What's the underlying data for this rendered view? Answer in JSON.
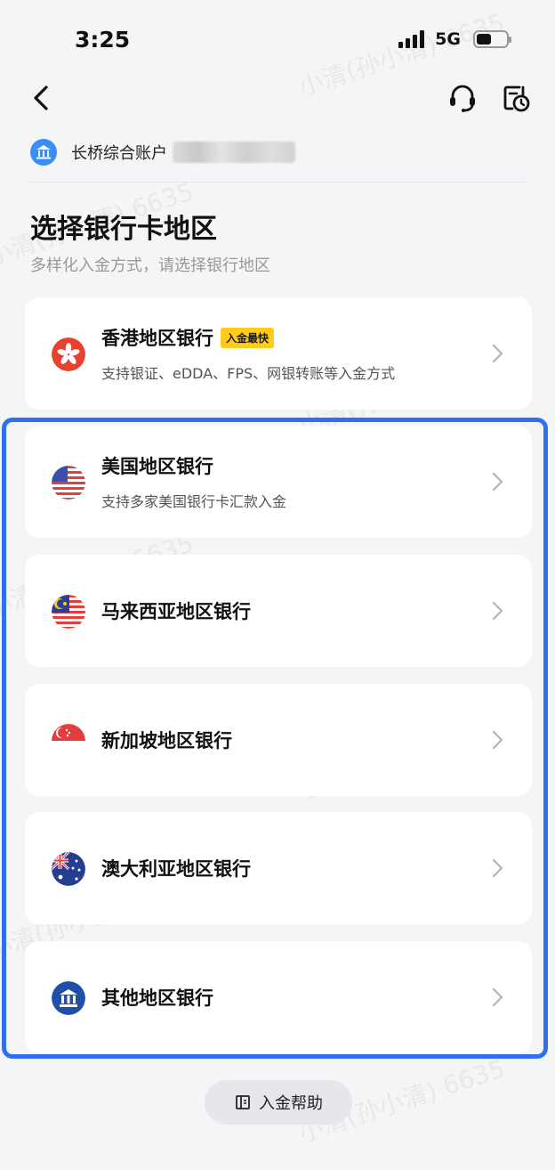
{
  "status_bar": {
    "time": "3:25",
    "network": "5G"
  },
  "account": {
    "name": "长桥综合账户"
  },
  "page": {
    "title": "选择银行卡地区",
    "subtitle": "多样化入金方式，请选择银行地区"
  },
  "regions": [
    {
      "title": "香港地区银行",
      "badge": "入金最快",
      "desc": "支持银证、eDDA、FPS、网银转账等入金方式",
      "icon": "hong-kong-flag-icon"
    },
    {
      "title": "美国地区银行",
      "desc": "支持多家美国银行卡汇款入金",
      "icon": "us-flag-icon"
    },
    {
      "title": "马来西亚地区银行",
      "icon": "malaysia-flag-icon"
    },
    {
      "title": "新加坡地区银行",
      "icon": "singapore-flag-icon"
    },
    {
      "title": "澳大利亚地区银行",
      "icon": "australia-flag-icon"
    },
    {
      "title": "其他地区银行",
      "icon": "bank-icon"
    }
  ],
  "footer": {
    "help_label": "入金帮助"
  },
  "watermark": "小清(孙小清) 6635",
  "colors": {
    "accent": "#2f6ff5",
    "badge": "#ffcc1a",
    "bank_badge": "#3a8ef6"
  }
}
